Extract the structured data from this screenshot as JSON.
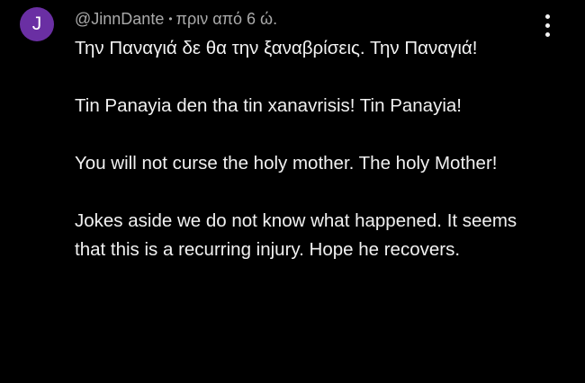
{
  "comment": {
    "avatar_letter": "J",
    "avatar_color": "#6a2fa3",
    "author": "@JinnDante",
    "separator": "•",
    "timestamp": "πριν από 6 ώ.",
    "more_icon": "vertical-ellipsis-icon",
    "paragraphs": [
      "Την Παναγιά δε θα την ξαναβρίσεις. Την Παναγιά!",
      "Tin Panayia den tha tin xanavrisis! Tin Panayia!",
      "You will not curse the holy mother. The holy Mother!",
      "Jokes aside we do not know what happened. It seems that this is a recurring injury. Hope he recovers."
    ]
  }
}
